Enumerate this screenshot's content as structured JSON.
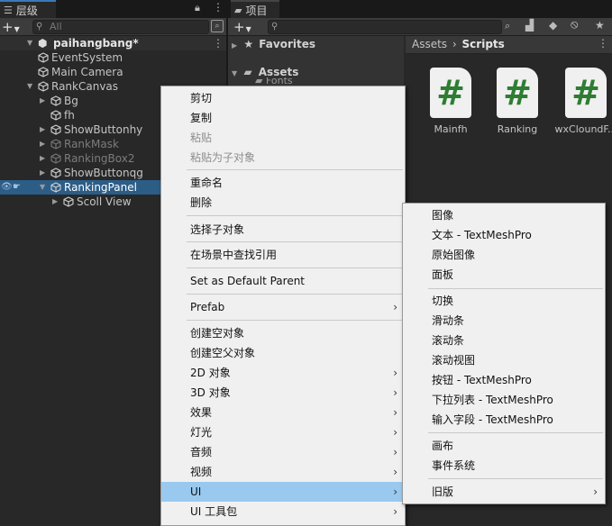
{
  "hierarchy": {
    "tab_label": "层级",
    "search_placeholder": "All",
    "scene_name": "paihangbang*",
    "items": [
      {
        "label": "EventSystem",
        "state": "normal"
      },
      {
        "label": "Main Camera",
        "state": "normal"
      },
      {
        "label": "RankCanvas",
        "state": "normal"
      },
      {
        "label": "Bg",
        "state": "normal"
      },
      {
        "label": "fh",
        "state": "normal"
      },
      {
        "label": "ShowButtonhy",
        "state": "normal"
      },
      {
        "label": "RankMask",
        "state": "dim"
      },
      {
        "label": "RankingBox2",
        "state": "dim"
      },
      {
        "label": "ShowButtonqg",
        "state": "normal"
      },
      {
        "label": "RankingPanel",
        "state": "selected"
      },
      {
        "label": "Scoll View",
        "state": "normal"
      }
    ]
  },
  "project": {
    "tab_label": "项目",
    "favorites": "Favorites",
    "assets": "Assets",
    "fonts_partial": "Fonts",
    "breadcrumb": {
      "root": "Assets",
      "sep": "›",
      "current": "Scripts"
    },
    "files": [
      {
        "name": "Mainfh",
        "glyph": "#"
      },
      {
        "name": "Ranking",
        "glyph": "#"
      },
      {
        "name": "wxCloundF...",
        "glyph": "#"
      }
    ],
    "hidden_count_symbol": "⦸"
  },
  "context_menu": {
    "items": [
      {
        "label": "剪切",
        "disabled": false
      },
      {
        "label": "复制",
        "disabled": false
      },
      {
        "label": "粘贴",
        "disabled": true
      },
      {
        "label": "粘贴为子对象",
        "disabled": true
      },
      {
        "label": "重命名",
        "disabled": false
      },
      {
        "label": "删除",
        "disabled": false
      },
      {
        "label": "选择子对象",
        "disabled": false
      },
      {
        "label": "在场景中查找引用",
        "disabled": false
      },
      {
        "label": "Set as Default Parent",
        "disabled": false
      },
      {
        "label": "Prefab",
        "submenu": true
      },
      {
        "label": "创建空对象"
      },
      {
        "label": "创建空父对象"
      },
      {
        "label": "2D 对象",
        "submenu": true
      },
      {
        "label": "3D 对象",
        "submenu": true
      },
      {
        "label": "效果",
        "submenu": true
      },
      {
        "label": "灯光",
        "submenu": true
      },
      {
        "label": "音频",
        "submenu": true
      },
      {
        "label": "视频",
        "submenu": true
      },
      {
        "label": "UI",
        "submenu": true,
        "highlighted": true
      },
      {
        "label": "UI 工具包",
        "submenu": true
      }
    ],
    "arrow": "›"
  },
  "ui_submenu": {
    "items": [
      {
        "label": "图像"
      },
      {
        "label": "文本 - TextMeshPro"
      },
      {
        "label": "原始图像"
      },
      {
        "label": "面板"
      },
      {
        "label": "切换"
      },
      {
        "label": "滑动条"
      },
      {
        "label": "滚动条"
      },
      {
        "label": "滚动视图"
      },
      {
        "label": "按钮 - TextMeshPro"
      },
      {
        "label": "下拉列表 - TextMeshPro"
      },
      {
        "label": "输入字段 - TextMeshPro"
      },
      {
        "label": "画布"
      },
      {
        "label": "事件系统"
      },
      {
        "label": "旧版",
        "submenu": true
      }
    ],
    "arrow": "›"
  },
  "colors": {
    "selection": "#2c5d87",
    "menu_highlight": "#99c9ef",
    "script_hash": "#2e7d32"
  }
}
